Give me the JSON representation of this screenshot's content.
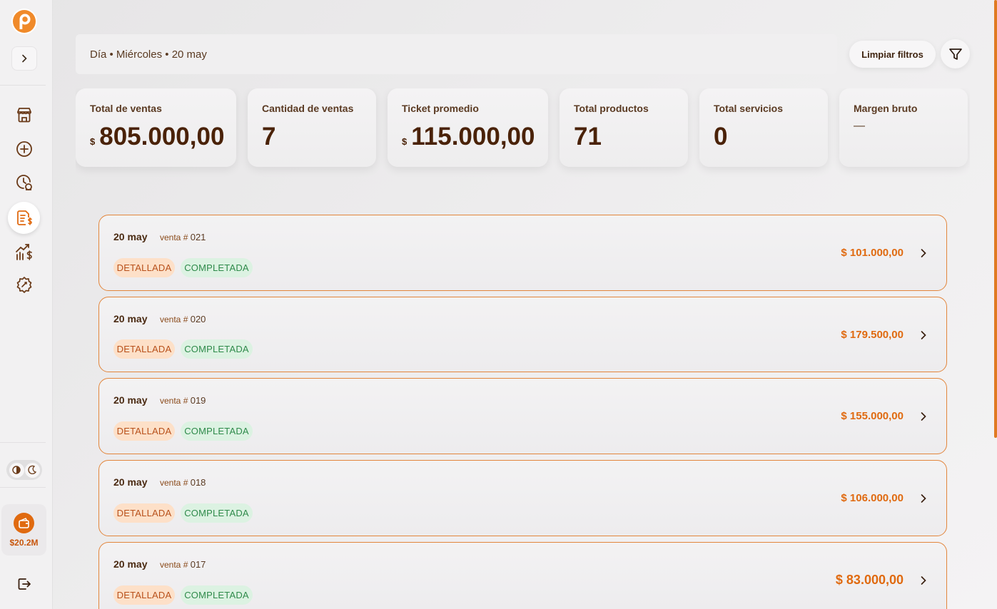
{
  "sidebar": {
    "logo": "p-logo",
    "expand_icon": "chevron-right-icon",
    "nav": [
      {
        "name": "store-icon",
        "active": false
      },
      {
        "name": "plus-circle-icon",
        "active": false
      },
      {
        "name": "history-icon",
        "active": false
      },
      {
        "name": "sales-document-icon",
        "active": true
      },
      {
        "name": "stats-chart-icon",
        "active": false
      },
      {
        "name": "settings-icon",
        "active": false
      }
    ],
    "wallet_amount": "$20.2M"
  },
  "filter": {
    "label": "Día • Miércoles • 20 may",
    "clear_label": "Limpiar filtros"
  },
  "stats": [
    {
      "label": "Total de ventas",
      "currency": "$",
      "value": "805.000,00"
    },
    {
      "label": "Cantidad de ventas",
      "currency": "",
      "value": "7"
    },
    {
      "label": "Ticket promedio",
      "currency": "$",
      "value": "115.000,00"
    },
    {
      "label": "Total productos",
      "currency": "",
      "value": "71"
    },
    {
      "label": "Total servicios",
      "currency": "",
      "value": "0"
    },
    {
      "label": "Margen bruto",
      "currency": "",
      "value": "—"
    }
  ],
  "sales": [
    {
      "date": "20 may",
      "prefix": "venta #",
      "number": "021",
      "badge1": "DETALLADA",
      "badge2": "COMPLETADA",
      "amount": "$ 101.000,00"
    },
    {
      "date": "20 may",
      "prefix": "venta #",
      "number": "020",
      "badge1": "DETALLADA",
      "badge2": "COMPLETADA",
      "amount": "$ 179.500,00"
    },
    {
      "date": "20 may",
      "prefix": "venta #",
      "number": "019",
      "badge1": "DETALLADA",
      "badge2": "COMPLETADA",
      "amount": "$ 155.000,00"
    },
    {
      "date": "20 may",
      "prefix": "venta #",
      "number": "018",
      "badge1": "DETALLADA",
      "badge2": "COMPLETADA",
      "amount": "$ 106.000,00"
    },
    {
      "date": "20 may",
      "prefix": "venta #",
      "number": "017",
      "badge1": "DETALLADA",
      "badge2": "COMPLETADA",
      "amount": "$ 83.000,00"
    }
  ],
  "colors": {
    "accent": "#e06a10",
    "brown": "#4a2208",
    "badge_detallada_bg": "#fde0c8",
    "badge_completada_bg": "#dcf2e2"
  }
}
